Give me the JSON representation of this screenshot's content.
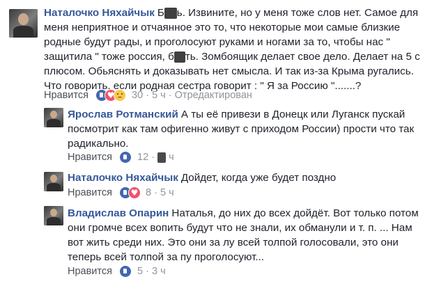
{
  "comments": [
    {
      "author": "Наталочко Няхайчык",
      "text_parts": [
        "",
        "ь. Извините, но у меня тоже слов нет. Самое для меня неприятное и отчаянное это то, что некоторые мои самые близкие родные будут рады, и проголосуют руками и ногами за то, чтобы нас \" защитила \" тоже россия, ",
        "ть. Зомбоящик делает свое дело. Делает на 5 с плюсом. Обьяснять и доказывать нет смысла. И так из-за Крыма ругались. Что говорить, если родная сестра говорит : \" Я за Россию \".......?"
      ],
      "like_label": "Нравится",
      "reactions": [
        "like",
        "love",
        "sad"
      ],
      "reaction_count": "30",
      "time": "5 ч",
      "edited_label": "Отредактирован"
    },
    {
      "author": "Ярослав Ротманский",
      "text": "А ты её привези в Донецк или Луганск пускай посмотрит как там офигенно живут с приходом России) прости что так радикально.",
      "like_label": "Нравится",
      "reactions": [
        "like"
      ],
      "reaction_count": "12",
      "time": "ч"
    },
    {
      "author": "Наталочко Няхайчык",
      "text": "Дойдет, когда уже будет поздно",
      "like_label": "Нравится",
      "reactions": [
        "like",
        "love"
      ],
      "reaction_count": "8",
      "time": "5 ч"
    },
    {
      "author": "Владислав Опарин",
      "text": "Наталья, до них до всех дойдёт. Вот только потом они громче всех вопить будут что не знали, их обманули и т. п. ... Нам вот жить среди них. Это они за лу всей толпой голосовали, это они теперь всей толпой за пу проголосуют...",
      "like_label": "Нравится",
      "reactions": [
        "like"
      ],
      "reaction_count": "5",
      "time": "3 ч"
    }
  ],
  "separator": "·"
}
